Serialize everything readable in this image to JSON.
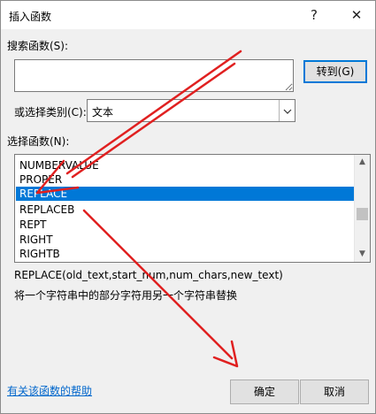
{
  "window": {
    "title": "插入函数",
    "help_glyph": "?",
    "close_glyph": "✕"
  },
  "search": {
    "label": "搜索函数(S):",
    "value": "",
    "go_button": "转到(G)"
  },
  "category": {
    "label": "或选择类别(C):",
    "selected": "文本"
  },
  "function_list": {
    "label": "选择函数(N):",
    "items": [
      "NUMBERVALUE",
      "PROPER",
      "REPLACE",
      "REPLACEB",
      "REPT",
      "RIGHT",
      "RIGHTB"
    ],
    "selected": "REPLACE"
  },
  "details": {
    "signature": "REPLACE(old_text,start_num,num_chars,new_text)",
    "description": "将一个字符串中的部分字符用另一个字符串替换"
  },
  "footer": {
    "help_link": "有关该函数的帮助",
    "ok": "确定",
    "cancel": "取消"
  },
  "colors": {
    "selection": "#0078d7",
    "annotation_arrow": "#e02020",
    "link": "#0066cc"
  }
}
